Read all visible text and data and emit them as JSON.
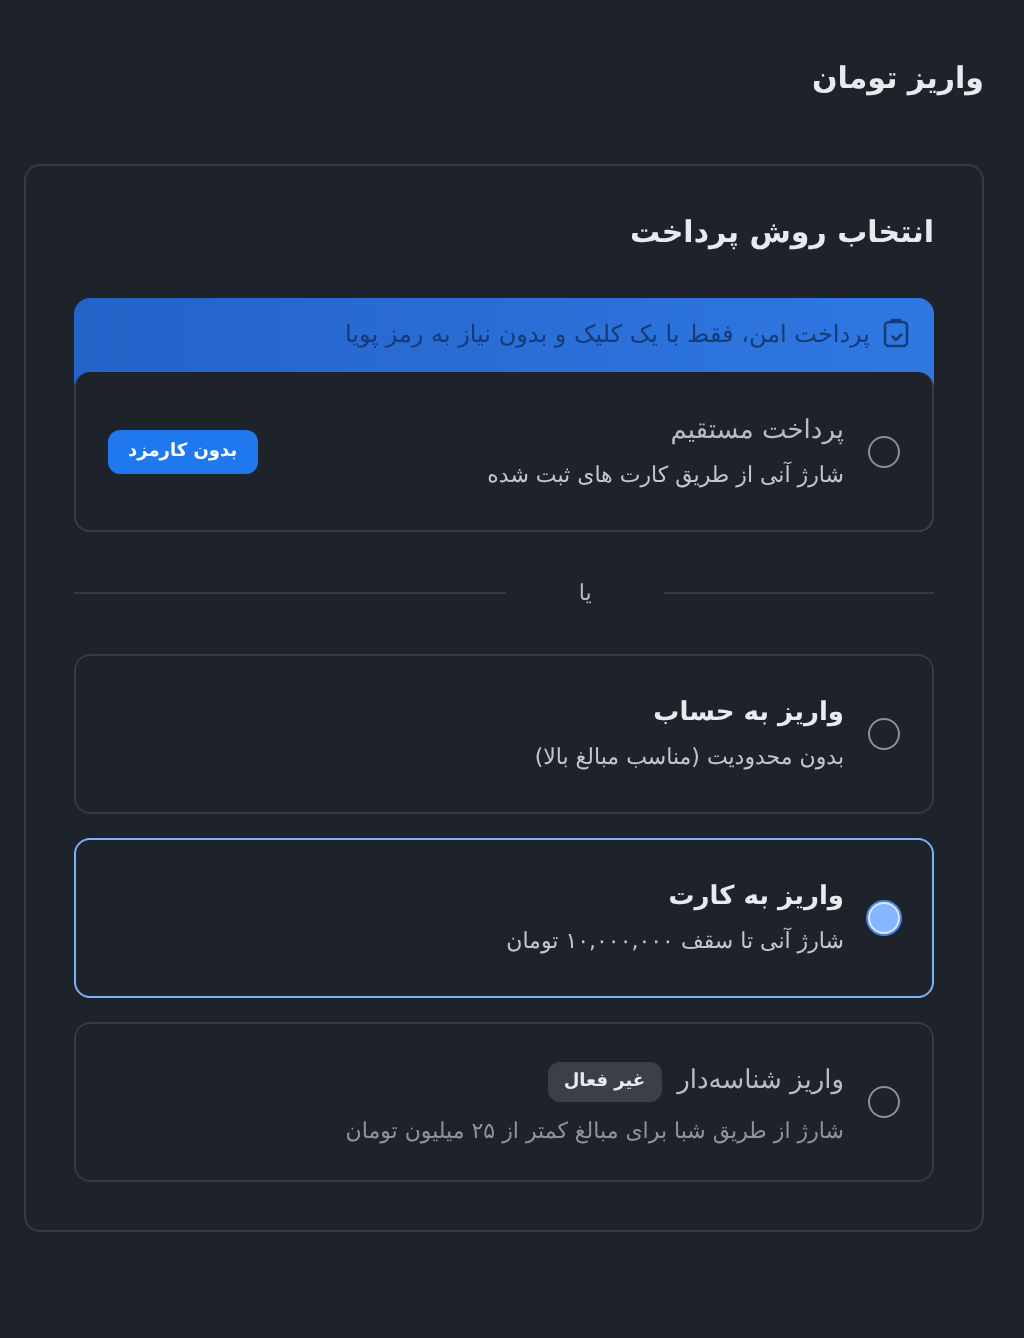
{
  "page_title": "واریز تومان",
  "card_title": "انتخاب روش پرداخت",
  "featured": {
    "banner": "پرداخت امن، فقط با یک کلیک و بدون نیاز به رمز پویا",
    "title": "پرداخت مستقیم",
    "description": "شارژ آنی از طریق کارت های ثبت شده",
    "badge": "بدون کارمزد",
    "selected": false
  },
  "divider": "یا",
  "options": [
    {
      "title": "واریز به حساب",
      "description": "بدون محدودیت (مناسب مبالغ بالا)",
      "selected": false,
      "disabled": false
    },
    {
      "title": "واریز به کارت",
      "description": "شارژ آنی تا سقف ۱۰,۰۰۰,۰۰۰ تومان",
      "selected": true,
      "disabled": false
    },
    {
      "title": "واریز شناسه‌دار",
      "description": "شارژ از طریق شبا برای مبالغ کمتر از ۲۵ میلیون تومان",
      "badge": "غیر فعال",
      "selected": false,
      "disabled": true
    }
  ]
}
